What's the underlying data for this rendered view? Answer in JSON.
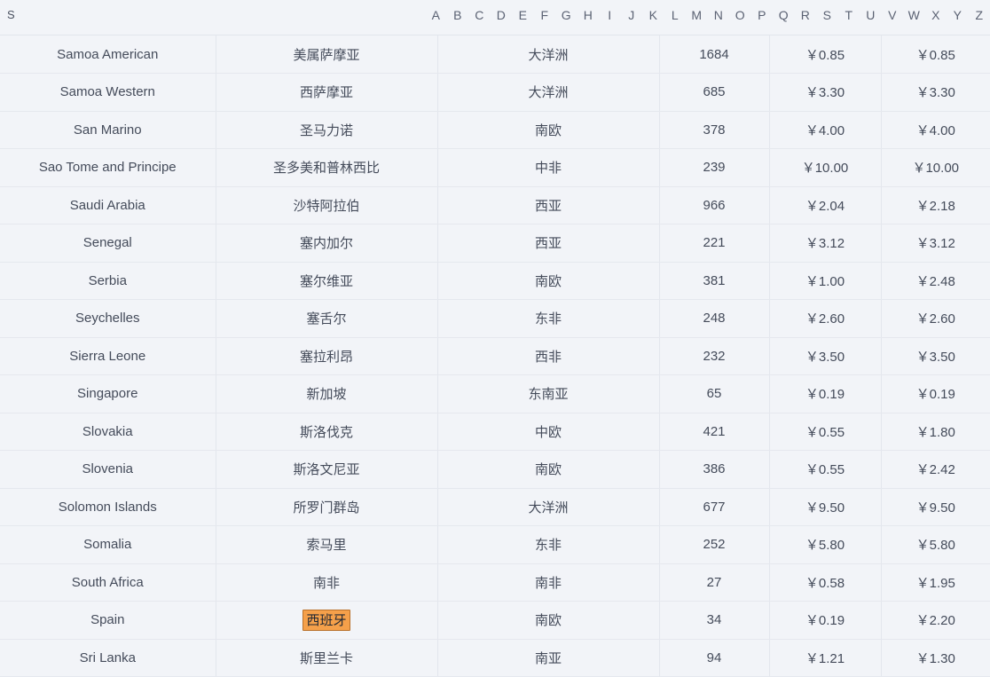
{
  "header": {
    "section_letter": "S",
    "alphabet": [
      "A",
      "B",
      "C",
      "D",
      "E",
      "F",
      "G",
      "H",
      "I",
      "J",
      "K",
      "L",
      "M",
      "N",
      "O",
      "P",
      "Q",
      "R",
      "S",
      "T",
      "U",
      "V",
      "W",
      "X",
      "Y",
      "Z"
    ]
  },
  "highlight": {
    "text": "西班牙",
    "background": "#f5a04a",
    "border_color": "#b9702a"
  },
  "table": {
    "rows": [
      {
        "en": "Samoa American",
        "zh": "美属萨摩亚",
        "region": "大洋洲",
        "code": "1684",
        "price1": "￥0.85",
        "price2": "￥0.85"
      },
      {
        "en": "Samoa Western",
        "zh": "西萨摩亚",
        "region": "大洋洲",
        "code": "685",
        "price1": "￥3.30",
        "price2": "￥3.30"
      },
      {
        "en": "San Marino",
        "zh": "圣马力诺",
        "region": "南欧",
        "code": "378",
        "price1": "￥4.00",
        "price2": "￥4.00"
      },
      {
        "en": "Sao Tome and Principe",
        "zh": "圣多美和普林西比",
        "region": "中非",
        "code": "239",
        "price1": "￥10.00",
        "price2": "￥10.00"
      },
      {
        "en": "Saudi Arabia",
        "zh": "沙特阿拉伯",
        "region": "西亚",
        "code": "966",
        "price1": "￥2.04",
        "price2": "￥2.18"
      },
      {
        "en": "Senegal",
        "zh": "塞内加尔",
        "region": "西亚",
        "code": "221",
        "price1": "￥3.12",
        "price2": "￥3.12"
      },
      {
        "en": "Serbia",
        "zh": "塞尔维亚",
        "region": "南欧",
        "code": "381",
        "price1": "￥1.00",
        "price2": "￥2.48"
      },
      {
        "en": "Seychelles",
        "zh": "塞舌尔",
        "region": "东非",
        "code": "248",
        "price1": "￥2.60",
        "price2": "￥2.60"
      },
      {
        "en": "Sierra Leone",
        "zh": "塞拉利昂",
        "region": "西非",
        "code": "232",
        "price1": "￥3.50",
        "price2": "￥3.50"
      },
      {
        "en": "Singapore",
        "zh": "新加坡",
        "region": "东南亚",
        "code": "65",
        "price1": "￥0.19",
        "price2": "￥0.19"
      },
      {
        "en": "Slovakia",
        "zh": "斯洛伐克",
        "region": "中欧",
        "code": "421",
        "price1": "￥0.55",
        "price2": "￥1.80"
      },
      {
        "en": "Slovenia",
        "zh": "斯洛文尼亚",
        "region": "南欧",
        "code": "386",
        "price1": "￥0.55",
        "price2": "￥2.42"
      },
      {
        "en": "Solomon Islands",
        "zh": "所罗门群岛",
        "region": "大洋洲",
        "code": "677",
        "price1": "￥9.50",
        "price2": "￥9.50"
      },
      {
        "en": "Somalia",
        "zh": "索马里",
        "region": "东非",
        "code": "252",
        "price1": "￥5.80",
        "price2": "￥5.80"
      },
      {
        "en": "South Africa",
        "zh": "南非",
        "region": "南非",
        "code": "27",
        "price1": "￥0.58",
        "price2": "￥1.95"
      },
      {
        "en": "Spain",
        "zh": "西班牙",
        "region": "南欧",
        "code": "34",
        "price1": "￥0.19",
        "price2": "￥2.20",
        "highlighted": true
      },
      {
        "en": "Sri Lanka",
        "zh": "斯里兰卡",
        "region": "南亚",
        "code": "94",
        "price1": "￥1.21",
        "price2": "￥1.30"
      }
    ]
  }
}
